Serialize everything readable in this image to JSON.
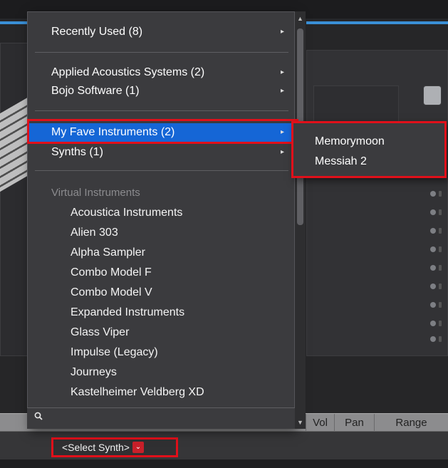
{
  "menu": {
    "recently_used": "Recently Used (8)",
    "applied_acoustics": "Applied Acoustics Systems (2)",
    "bojo_software": "Bojo Software (1)",
    "my_fave_instruments": "My Fave Instruments (2)",
    "synths": "Synths (1)",
    "virtual_instruments_header": "Virtual Instruments",
    "virtual_instruments": [
      "Acoustica Instruments",
      "Alien 303",
      "Alpha Sampler",
      "Combo Model F",
      "Combo Model V",
      "Expanded Instruments",
      "Glass Viper",
      "Impulse (Legacy)",
      "Journeys",
      "Kastelheimer Veldberg XD"
    ],
    "submenu_arrow": "▸"
  },
  "submenu": {
    "items": [
      "Memorymoon",
      "Messiah 2"
    ]
  },
  "search": {
    "icon": "search-icon",
    "value": ""
  },
  "track_header": {
    "vol": "Vol",
    "pan": "Pan",
    "range": "Range"
  },
  "select_synth": {
    "label": "<Select Synth>",
    "arrow": "⌄"
  },
  "colors": {
    "highlight": "#1566d6",
    "annotation_red": "#e0101a",
    "menu_bg": "#3b3b3e"
  }
}
